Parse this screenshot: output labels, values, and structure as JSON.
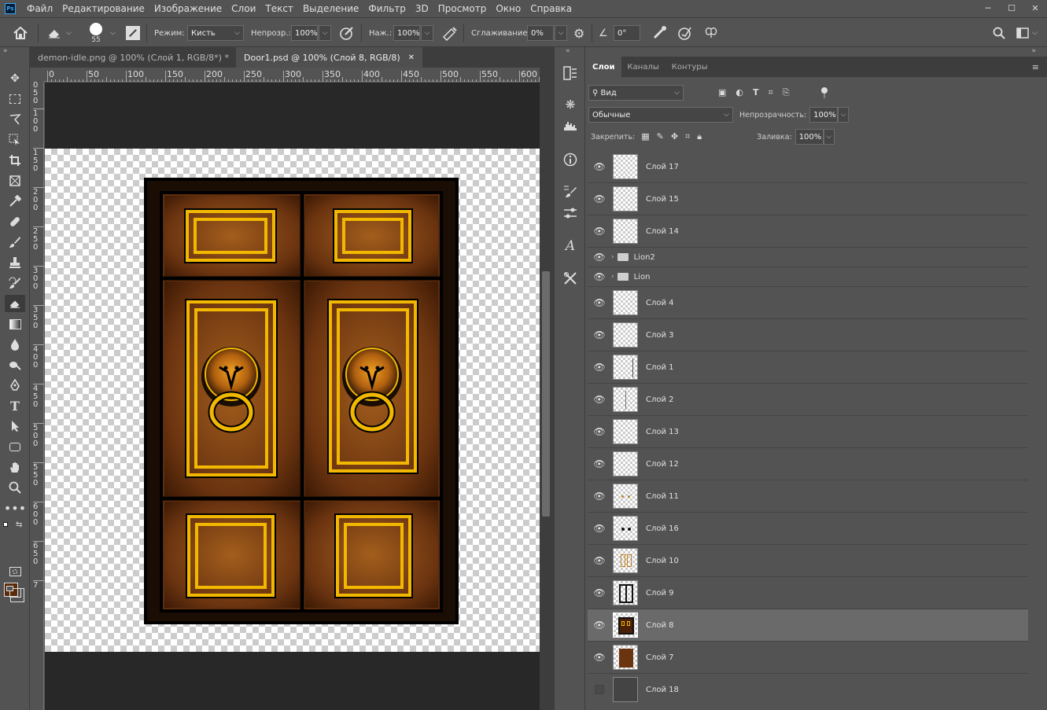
{
  "app": {
    "logo": "Ps"
  },
  "menu": [
    "Файл",
    "Редактирование",
    "Изображение",
    "Слои",
    "Текст",
    "Выделение",
    "Фильтр",
    "3D",
    "Просмотр",
    "Окно",
    "Справка"
  ],
  "options": {
    "brush_size": "55",
    "mode_label": "Режим:",
    "mode_value": "Кисть",
    "opacity_label": "Непрозр.:",
    "opacity_value": "100%",
    "flow_label": "Наж.:",
    "flow_value": "100%",
    "smoothing_label": "Сглаживание:",
    "smoothing_value": "0%",
    "angle_value": "0°"
  },
  "doc_tabs": [
    {
      "label": "demon-idle.png @ 100% (Слой 1, RGB/8*) *"
    },
    {
      "label": "Door1.psd @ 100% (Слой 8, RGB/8)"
    }
  ],
  "ruler": {
    "top": [
      "0",
      "50",
      "100",
      "150",
      "200",
      "250",
      "300",
      "350",
      "400",
      "450",
      "500",
      "550",
      "600"
    ],
    "left": [
      "1\n0\n0",
      "1\n5\n0",
      "2\n0\n0",
      "2\n5\n0",
      "3\n0\n0",
      "3\n5\n0",
      "4\n0\n0",
      "4\n5\n0",
      "5\n0\n0",
      "5\n5\n0",
      "6\n0\n0",
      "6\n5\n0",
      "7"
    ]
  },
  "panel": {
    "tabs": [
      "Слои",
      "Каналы",
      "Контуры"
    ],
    "filter_kind": "Вид",
    "blend_mode": "Обычные",
    "opacity_label": "Непрозрачность:",
    "opacity_value": "100%",
    "lock_label": "Закрепить:",
    "fill_label": "Заливка:",
    "fill_value": "100%"
  },
  "layers": [
    {
      "name": "Слой 17",
      "type": "layer",
      "visible": true
    },
    {
      "name": "Слой 15",
      "type": "layer",
      "visible": true
    },
    {
      "name": "Слой 14",
      "type": "layer",
      "visible": true
    },
    {
      "name": "Lion2",
      "type": "group",
      "visible": true
    },
    {
      "name": "Lion",
      "type": "group",
      "visible": true
    },
    {
      "name": "Слой 4",
      "type": "layer",
      "visible": true
    },
    {
      "name": "Слой 3",
      "type": "layer",
      "visible": true
    },
    {
      "name": "Слой 1",
      "type": "layer",
      "visible": true
    },
    {
      "name": "Слой 2",
      "type": "layer",
      "visible": true
    },
    {
      "name": "Слой 13",
      "type": "layer",
      "visible": true
    },
    {
      "name": "Слой 12",
      "type": "layer",
      "visible": true
    },
    {
      "name": "Слой 11",
      "type": "layer",
      "visible": true
    },
    {
      "name": "Слой 16",
      "type": "layer",
      "visible": true
    },
    {
      "name": "Слой 10",
      "type": "layer",
      "visible": true
    },
    {
      "name": "Слой 9",
      "type": "layer",
      "visible": true
    },
    {
      "name": "Слой 8",
      "type": "layer",
      "visible": true,
      "selected": true
    },
    {
      "name": "Слой 7",
      "type": "layer",
      "visible": true
    },
    {
      "name": "Слой 18",
      "type": "layer",
      "visible": false
    }
  ],
  "colors": {
    "foreground": "#5a2a0a",
    "background": "#1a1a1a",
    "door_brown": "#6b3410",
    "gold": "#f2b800"
  }
}
